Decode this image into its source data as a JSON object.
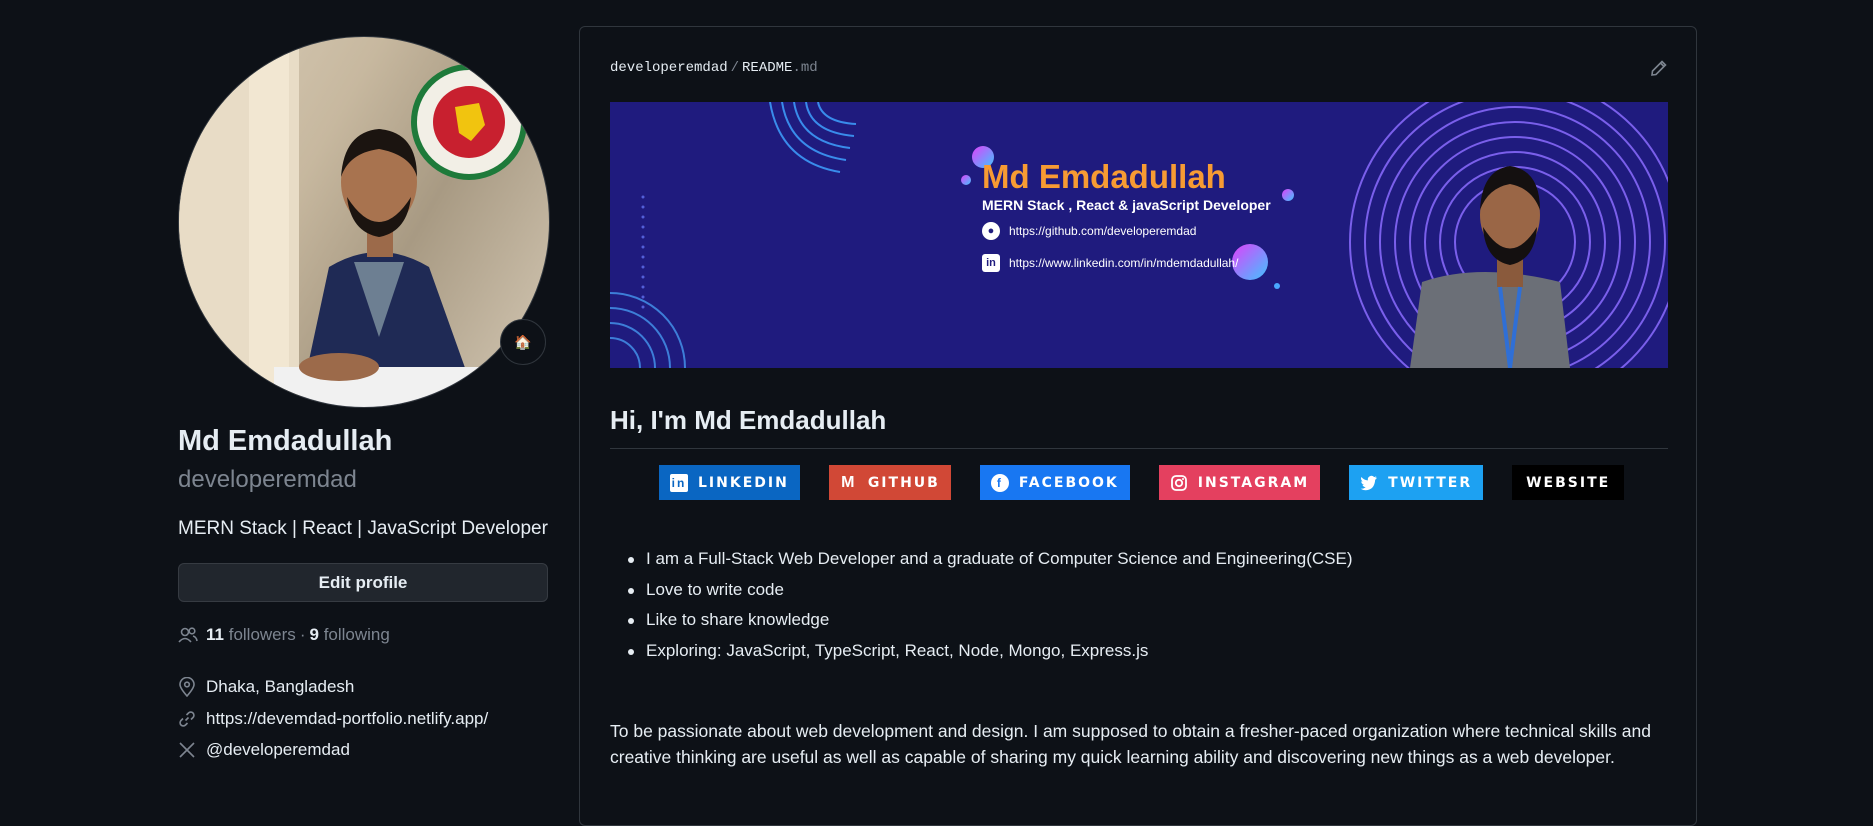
{
  "profile": {
    "status_emoji": "🏠",
    "name": "Md Emdadullah",
    "login": "developeremdad",
    "bio": "MERN Stack | React | JavaScript Developer",
    "edit_label": "Edit profile",
    "followers_count": "11",
    "followers_label": "followers",
    "separator": "·",
    "following_count": "9",
    "following_label": "following",
    "location": "Dhaka, Bangladesh",
    "website": "https://devemdad-portfolio.netlify.app/",
    "x_handle": "@developeremdad"
  },
  "readme": {
    "crumb_owner": "developeremdad",
    "crumb_sep": "/",
    "crumb_file": "README",
    "crumb_ext": ".md",
    "banner": {
      "name": "Md Emdadullah",
      "role": "MERN Stack , React & javaScript  Developer",
      "github_url": "https://github.com/developeremdad",
      "linkedin_url": "https://www.linkedin.com/in/mdemdadullah/"
    },
    "heading": "Hi, I'm Md Emdadullah",
    "badges": [
      {
        "label": "LINKEDIN",
        "icon": "linkedin-icon",
        "color": "#0a66c2"
      },
      {
        "label": "GITHUB",
        "icon": "gmail-icon",
        "color": "#d14836"
      },
      {
        "label": "FACEBOOK",
        "icon": "facebook-icon",
        "color": "#1877f2"
      },
      {
        "label": "INSTAGRAM",
        "icon": "instagram-icon",
        "color": "#e4405f"
      },
      {
        "label": "TWITTER",
        "icon": "twitter-icon",
        "color": "#1da1f2"
      },
      {
        "label": "WEBSITE",
        "icon": "",
        "color": "#000000"
      }
    ],
    "list": [
      "I am a Full-Stack Web Developer and a graduate of Computer Science and Engineering(CSE)",
      "Love to write code",
      "Like to share knowledge",
      "Exploring: JavaScript, TypeScript, React, Node, Mongo, Express.js"
    ],
    "paragraph": "To be passionate about web development and design. I am supposed to obtain a fresher-paced organization where technical skills and creative thinking are useful as well as capable of sharing my quick learning ability and discovering new things as a web developer."
  }
}
